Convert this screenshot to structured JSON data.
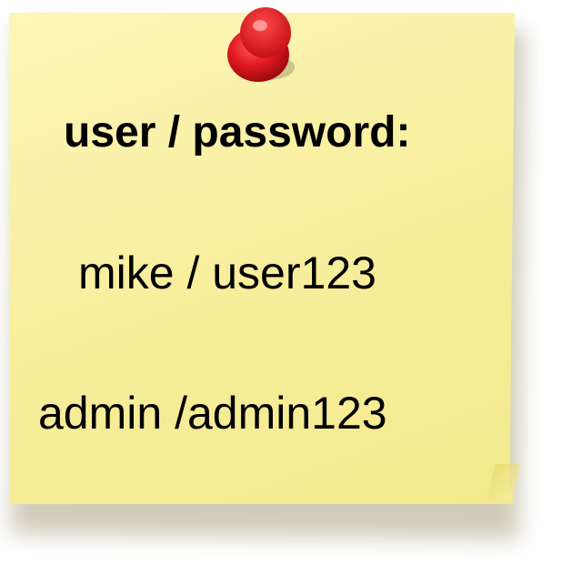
{
  "note": {
    "background_color": "#f8efa0",
    "pin_icon": "push-pin-icon",
    "pin_color": "#e11920",
    "heading": "user / password:",
    "credentials": [
      {
        "text": "mike / user123"
      },
      {
        "text": "admin /admin123"
      }
    ]
  }
}
